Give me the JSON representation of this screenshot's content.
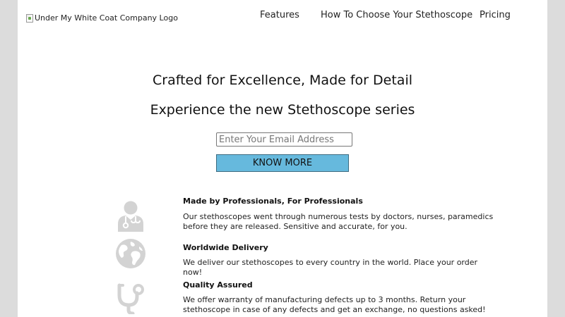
{
  "header": {
    "logo_alt": "Under My White Coat Company Logo",
    "nav": [
      {
        "label": "Features"
      },
      {
        "label": "How To Choose Your Stethoscope"
      },
      {
        "label": "Pricing"
      }
    ]
  },
  "hero": {
    "title": "Crafted for Excellence, Made for Detail",
    "subtitle": "Experience the new Stethoscope series",
    "email_placeholder": "Enter Your Email Address",
    "email_value": "",
    "button_label": "KNOW MORE"
  },
  "features": [
    {
      "icon": "doctor-icon",
      "title": "Made by Professionals, For Professionals",
      "text": "Our stethoscopes went through numerous tests by doctors, nurses, paramedics before they are released. Sensitive and accurate, for you."
    },
    {
      "icon": "globe-icon",
      "title": "Worldwide Delivery",
      "text": "We deliver our stethoscopes to every country in the world. Place your order now!"
    },
    {
      "icon": "stethoscope-icon",
      "title": "Quality Assured",
      "text": "We offer warranty of manufacturing defects up to 3 months. Return your stethoscope in case of any defects and get an exchange, no questions asked!"
    }
  ],
  "colors": {
    "button": "#66b9dd",
    "icon": "#d3d3d3",
    "outer_background": "#dcdcdc"
  }
}
